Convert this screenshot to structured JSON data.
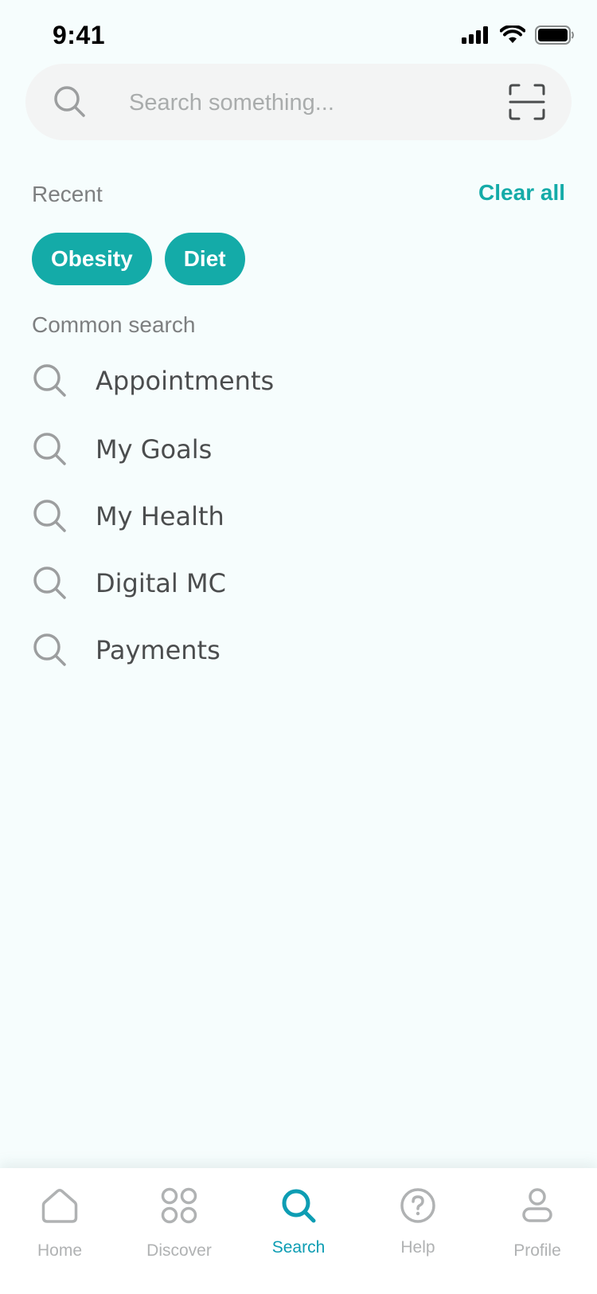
{
  "status_bar": {
    "time": "9:41"
  },
  "search": {
    "placeholder": "Search something..."
  },
  "recent": {
    "label": "Recent",
    "clear_label": "Clear all",
    "chips": [
      "Obesity",
      "Diet"
    ]
  },
  "common": {
    "label": "Common search",
    "items": [
      "Appointments",
      "My Goals",
      "My Health",
      "Digital MC",
      "Payments"
    ]
  },
  "tabs": [
    {
      "label": "Home",
      "icon": "home-icon"
    },
    {
      "label": "Discover",
      "icon": "grid-icon"
    },
    {
      "label": "Search",
      "icon": "search-icon",
      "active": true
    },
    {
      "label": "Help",
      "icon": "help-icon"
    },
    {
      "label": "Profile",
      "icon": "profile-icon"
    }
  ],
  "colors": {
    "accent": "#14aba8",
    "active_tab": "#0d9db3",
    "background": "#f6fdfd"
  }
}
